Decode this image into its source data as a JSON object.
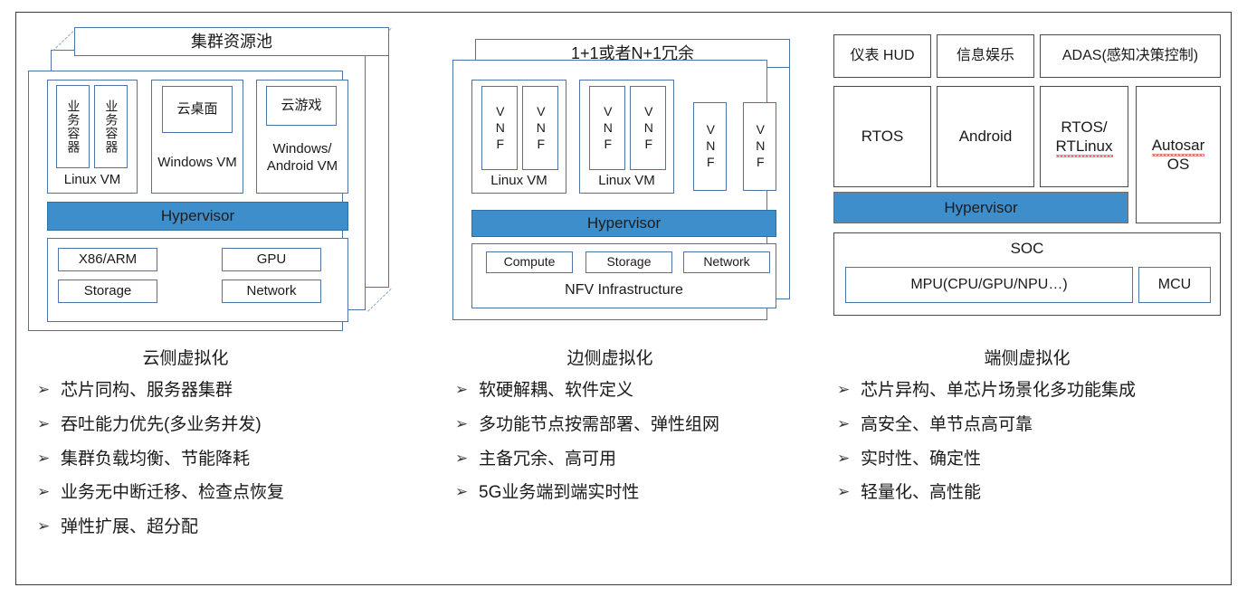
{
  "diagram": {
    "panels": {
      "cloud": {
        "stack_title": "集群资源池",
        "vm_groups": [
          {
            "name": "Linux VM",
            "apps": [
              "业务容器",
              "业务容器"
            ]
          },
          {
            "name": "Windows VM",
            "apps": [
              "云桌面"
            ]
          },
          {
            "name": "Windows/ Android VM",
            "apps": [
              "云游戏"
            ]
          }
        ],
        "hypervisor": "Hypervisor",
        "hardware": [
          "X86/ARM",
          "GPU",
          "Storage",
          "Network"
        ],
        "section_title": "云侧虚拟化",
        "bullets": [
          "芯片同构、服务器集群",
          "吞吐能力优先(多业务并发)",
          "集群负载均衡、节能降耗",
          "业务无中断迁移、检查点恢复",
          "弹性扩展、超分配"
        ]
      },
      "edge": {
        "stack_title": "1+1或者N+1冗余",
        "vm_groups": [
          {
            "name": "Linux VM",
            "vnfs": [
              "VNF",
              "VNF"
            ]
          },
          {
            "name": "Linux VM",
            "vnfs": [
              "VNF",
              "VNF"
            ]
          }
        ],
        "standalone_vnfs": [
          "VNF",
          "VNF"
        ],
        "hypervisor": "Hypervisor",
        "infra_title": "NFV Infrastructure",
        "infra_blocks": [
          "Compute",
          "Storage",
          "Network"
        ],
        "section_title": "边侧虚拟化",
        "bullets": [
          "软硬解耦、软件定义",
          "多功能节点按需部署、弹性组网",
          "主备冗余、高可用",
          "5G业务端到端实时性"
        ]
      },
      "device": {
        "apps": [
          "仪表 HUD",
          "信息娱乐",
          "ADAS(感知决策控制)"
        ],
        "os_blocks": [
          "RTOS",
          "Android",
          "RTOS/ RTLinux"
        ],
        "autosar": "Autosar OS",
        "autosar_word": "Autosar",
        "autosar_tail": "OS",
        "rtlinux_head": "RTOS/",
        "rtlinux_word": "RTLinux",
        "hypervisor": "Hypervisor",
        "soc_title": "SOC",
        "soc_blocks": [
          "MPU(CPU/GPU/NPU…)",
          "MCU"
        ],
        "section_title": "端侧虚拟化",
        "bullets": [
          "芯片异构、单芯片场景化多功能集成",
          "高安全、单节点高可靠",
          "实时性、确定性",
          "轻量化、高性能"
        ]
      }
    },
    "bullet_marker": "➢",
    "colors": {
      "hypervisor_fill": "#3f8ecc",
      "blue_border": "#4e73a8",
      "gray_border": "#4a4a4a",
      "frame_border": "#3b3b3b",
      "spellcheck_underline": "#e0635f",
      "text": "#1a1a1a"
    }
  }
}
